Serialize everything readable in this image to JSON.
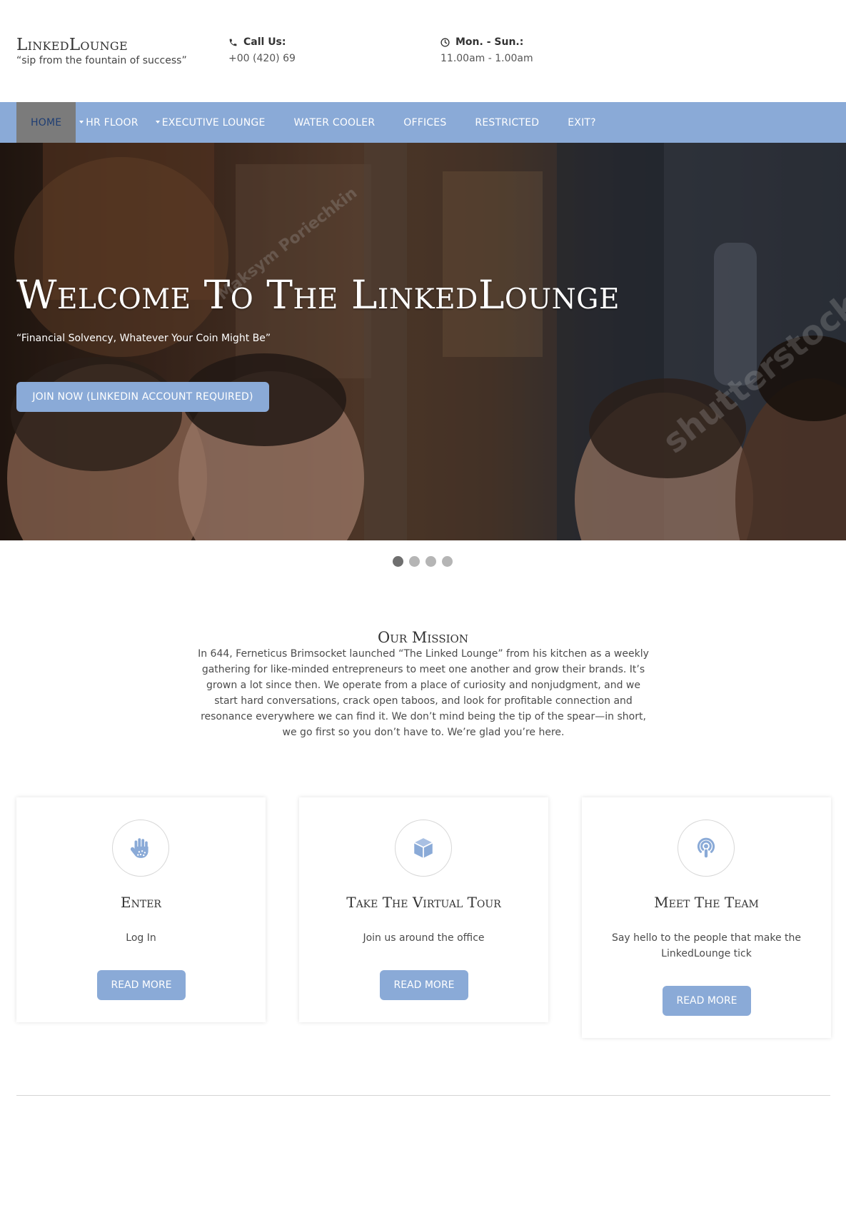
{
  "header": {
    "brand_name": "LinkedLounge",
    "brand_tagline": "“sip from the fountain of success”",
    "phone_label": "Call Us:",
    "phone_value": "+00 (420) 69",
    "hours_label": "Mon. - Sun.:",
    "hours_value": "11.00am - 1.00am"
  },
  "nav": {
    "items": [
      {
        "label": "HOME"
      },
      {
        "label": "HR FLOOR"
      },
      {
        "label": "EXECUTIVE LOUNGE"
      },
      {
        "label": "WATER COOLER"
      },
      {
        "label": "OFFICES"
      },
      {
        "label": "RESTRICTED"
      },
      {
        "label": "EXIT?"
      }
    ]
  },
  "hero": {
    "title": "Welcome To The LinkedLounge",
    "subtitle": "“Financial Solvency, Whatever Your Coin Might Be”",
    "button": "JOIN NOW (LINKEDIN ACCOUNT REQUIRED)",
    "watermark_1": "Maksym Poriechkin",
    "watermark_2": "shutterstock"
  },
  "carousel": {
    "slide_count": 4,
    "active_index": 0
  },
  "mission": {
    "title": "Our Mission",
    "text": "In 644, Ferneticus Brimsocket launched “The Linked Lounge” from his kitchen as a weekly gathering for like-minded entrepreneurs to meet one another and grow their brands. It’s grown a lot since then. We operate from a place of curiosity and nonjudgment, and we start hard conversations, crack open taboos, and look for profitable connection and resonance everywhere we can find it. We don’t mind being the tip of the spear—in short, we go first so you don’t have to. We’re glad you’re here."
  },
  "cards": [
    {
      "icon": "hand-icon",
      "title": "Enter",
      "text": "Log In",
      "button": "READ MORE"
    },
    {
      "icon": "cube-icon",
      "title": "Take The Virtual Tour",
      "text": "Join us around the office",
      "button": "READ MORE"
    },
    {
      "icon": "podcast-icon",
      "title": "Meet The Team",
      "text": "Say hello to the people that make the LinkedLounge tick",
      "button": "READ MORE"
    }
  ],
  "colors": {
    "accent": "#8aaad7",
    "nav_active_bg": "#7b7b7b",
    "nav_active_text": "#1f3e73",
    "text": "#4b4b4b"
  }
}
